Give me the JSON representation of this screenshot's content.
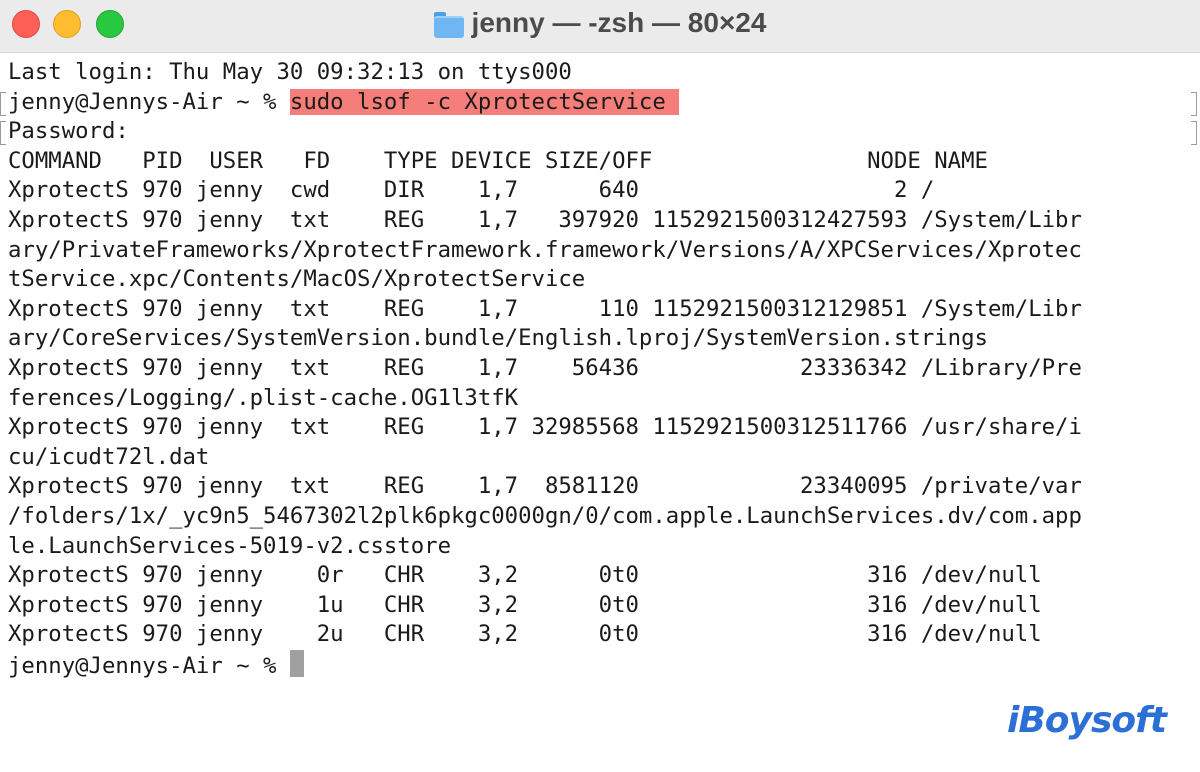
{
  "window": {
    "title": "jenny — -zsh — 80×24"
  },
  "terminal": {
    "lines": [
      {
        "text": "Last login: Thu May 30 09:32:13 on ttys000"
      },
      {
        "prefix": "jenny@Jennys-Air ~ % ",
        "command": "sudo lsof -c XprotectService ",
        "marked": true
      },
      {
        "text": "Password:",
        "marked": true
      },
      {
        "text": "COMMAND   PID  USER   FD    TYPE DEVICE SIZE/OFF                NODE NAME"
      },
      {
        "text": "XprotectS 970 jenny  cwd    DIR    1,7      640                   2 /"
      },
      {
        "text": "XprotectS 970 jenny  txt    REG    1,7   397920 1152921500312427593 /System/Libr"
      },
      {
        "text": "ary/PrivateFrameworks/XprotectFramework.framework/Versions/A/XPCServices/Xprotec"
      },
      {
        "text": "tService.xpc/Contents/MacOS/XprotectService"
      },
      {
        "text": "XprotectS 970 jenny  txt    REG    1,7      110 1152921500312129851 /System/Libr"
      },
      {
        "text": "ary/CoreServices/SystemVersion.bundle/English.lproj/SystemVersion.strings"
      },
      {
        "text": "XprotectS 970 jenny  txt    REG    1,7    56436            23336342 /Library/Pre"
      },
      {
        "text": "ferences/Logging/.plist-cache.OG1l3tfK"
      },
      {
        "text": "XprotectS 970 jenny  txt    REG    1,7 32985568 1152921500312511766 /usr/share/i"
      },
      {
        "text": "cu/icudt72l.dat"
      },
      {
        "text": "XprotectS 970 jenny  txt    REG    1,7  8581120            23340095 /private/var"
      },
      {
        "text": "/folders/1x/_yc9n5_5467302l2plk6pkgc0000gn/0/com.apple.LaunchServices.dv/com.app"
      },
      {
        "text": "le.LaunchServices-5019-v2.csstore"
      },
      {
        "text": "XprotectS 970 jenny    0r   CHR    3,2      0t0                 316 /dev/null"
      },
      {
        "text": "XprotectS 970 jenny    1u   CHR    3,2      0t0                 316 /dev/null"
      },
      {
        "text": "XprotectS 970 jenny    2u   CHR    3,2      0t0                 316 /dev/null"
      },
      {
        "text": "jenny@Jennys-Air ~ % ",
        "cursor": true
      }
    ]
  },
  "watermark": {
    "text": "iBoysoft"
  },
  "colors": {
    "highlight": "#f57e7a",
    "titlebar": "#ebebeb",
    "text": "#1a1a1a",
    "watermark": "#2c6fd6"
  }
}
